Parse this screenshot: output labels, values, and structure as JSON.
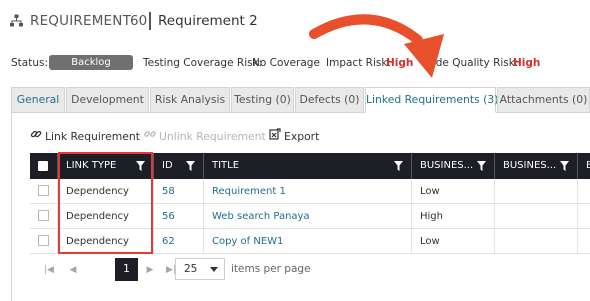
{
  "header": {
    "type_label": "REQUIREMENT",
    "id": "60",
    "name": "Requirement 2"
  },
  "status_bar": {
    "status_label": "Status:",
    "status_value": "Backlog",
    "testing_label": "Testing Coverage Risk:",
    "testing_value": "No Coverage",
    "impact_label": "Impact Risk:",
    "impact_value": "High",
    "code_label": "Code Quality Risk:",
    "code_value": "High",
    "high_color": "#d32f2f"
  },
  "tabs": [
    {
      "label": "General"
    },
    {
      "label": "Development"
    },
    {
      "label": "Risk Analysis"
    },
    {
      "label": "Testing (0)"
    },
    {
      "label": "Defects (0)"
    },
    {
      "label": "Linked Requirements (3)"
    },
    {
      "label": "Attachments (0)"
    }
  ],
  "toolbar": {
    "link_label": "Link Requirement",
    "unlink_label": "Unlink Requirement",
    "export_label": "Export"
  },
  "grid": {
    "columns": [
      "LINK TYPE",
      "ID",
      "TITLE",
      "BUSINES...",
      "BUSINES...",
      "B"
    ],
    "rows": [
      {
        "link_type": "Dependency",
        "id": "58",
        "title": "Requirement 1",
        "business": "Low"
      },
      {
        "link_type": "Dependency",
        "id": "56",
        "title": "Web search Panaya",
        "business": "High"
      },
      {
        "link_type": "Dependency",
        "id": "62",
        "title": "Copy of NEW1",
        "business": "Low"
      }
    ]
  },
  "pager": {
    "current_page": "1",
    "page_size": "25",
    "items_per_page_label": "items per page"
  },
  "colors": {
    "accent": "#1f6f8b",
    "header_dark": "#1e1f26",
    "callout_red": "#e53935",
    "arrow_orange": "#e8502b"
  },
  "icons": [
    "hierarchy-icon",
    "link-icon",
    "unlink-icon",
    "export-icon",
    "filter-icon",
    "first-page-icon",
    "prev-page-icon",
    "next-page-icon",
    "last-page-icon",
    "dropdown-arrow-icon"
  ]
}
